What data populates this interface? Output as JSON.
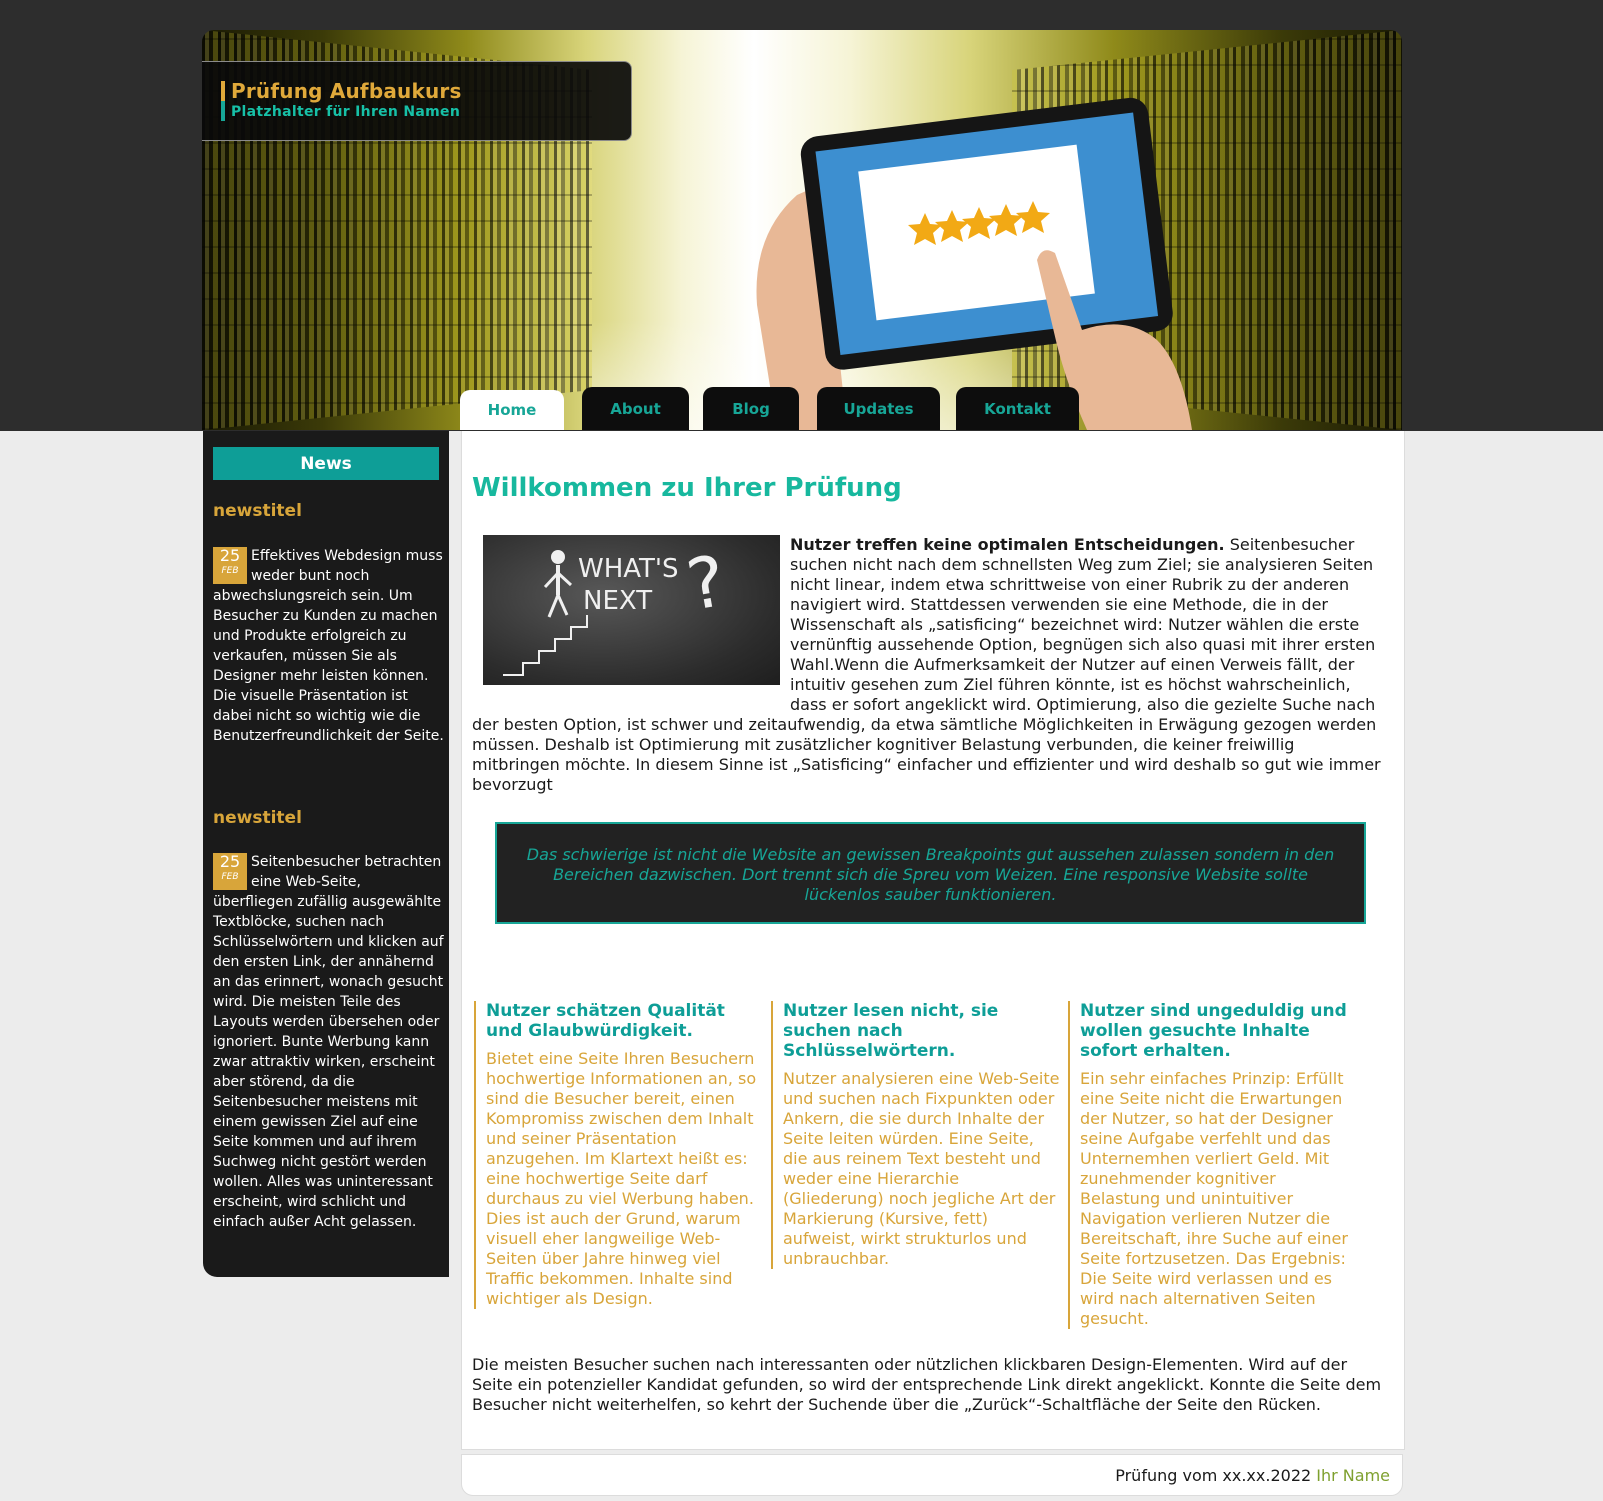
{
  "brand": {
    "title": "Prüfung Aufbaukurs",
    "subtitle": "Platzhalter für Ihren Namen"
  },
  "nav": {
    "items": [
      {
        "label": "Home",
        "active": true
      },
      {
        "label": "About",
        "active": false
      },
      {
        "label": "Blog",
        "active": false
      },
      {
        "label": "Updates",
        "active": false
      },
      {
        "label": "Kontakt",
        "active": false
      }
    ]
  },
  "sidebar": {
    "heading": "News",
    "posts": [
      {
        "title": "newstitel",
        "day": "25",
        "month": "FEB",
        "text": "Effektives Webdesign muss weder bunt noch abwechslungsreich sein. Um Besucher zu Kunden zu machen und Produkte erfolgreich zu verkaufen, müssen Sie als Designer mehr leisten können. Die visuelle Präsentation ist dabei nicht so wichtig wie die Benutzerfreundlichkeit der Seite."
      },
      {
        "title": "newstitel",
        "day": "25",
        "month": "FEB",
        "text": "Seitenbesucher betrachten eine Web-Seite, überfliegen zufällig ausgewählte Textblöcke, suchen nach Schlüsselwörtern und klicken auf den ersten Link, der annähernd an das erinnert, wonach gesucht wird. Die meisten Teile des Layouts werden übersehen oder ignoriert. Bunte Werbung kann zwar attraktiv wirken, erscheint aber störend, da die Seitenbesucher meistens mit einem gewissen Ziel auf eine Seite kommen und auf ihrem Suchweg nicht gestört werden wollen. Alles was uninteressant erscheint, wird schlicht und einfach außer Acht gelassen."
      }
    ]
  },
  "main": {
    "heading": "Willkommen zu Ihrer Prüfung",
    "image": {
      "line1": "WHAT'S",
      "line2": "NEXT",
      "line3": "?"
    },
    "intro_bold": "Nutzer treffen keine optimalen Entscheidungen.",
    "intro_text": " Seitenbesucher suchen nicht nach dem schnellsten Weg zum Ziel; sie analysieren Seiten nicht linear, indem etwa schrittweise von einer Rubrik zu der anderen navigiert wird. Stattdessen verwenden sie eine Methode, die in der Wissenschaft als „satisficing“ bezeichnet wird: Nutzer wählen die erste vernünftig aussehende Option, begnügen sich also quasi mit ihrer ersten Wahl.Wenn die Aufmerksamkeit der Nutzer auf einen Verweis fällt, der intuitiv gesehen zum Ziel führen könnte, ist es höchst wahrscheinlich, dass er sofort angeklickt wird. Optimierung, also die gezielte Suche nach der besten Option, ist schwer und zeitaufwendig, da etwa sämtliche Möglichkeiten in Erwägung gezogen werden müssen. Deshalb ist Optimierung mit zusätzlicher kognitiver Belastung verbunden, die keiner freiwillig mitbringen möchte. In diesem Sinne ist „Satisficing“ einfacher und effizienter und wird deshalb so gut wie immer bevorzugt",
    "quote": "Das schwierige ist nicht die Website an gewissen Breakpoints gut aussehen zulassen sondern in den Bereichen dazwischen. Dort trennt sich die Spreu vom Weizen. Eine responsive Website sollte lückenlos sauber funktionieren.",
    "columns": [
      {
        "title": "Nutzer schätzen Qualität und Glaubwürdigkeit.",
        "text": "Bietet eine Seite Ihren Besuchern hochwertige Informationen an, so sind die Besucher bereit, einen Kompromiss zwischen dem Inhalt und seiner Präsentation anzugehen. Im Klartext heißt es: eine hochwertige Seite darf durchaus zu viel Werbung haben. Dies ist auch der Grund, warum visuell eher langweilige Web-Seiten über Jahre hinweg viel Traffic bekommen. Inhalte sind wichtiger als Design."
      },
      {
        "title": "Nutzer lesen nicht, sie suchen nach Schlüsselwörtern.",
        "text": "Nutzer analysieren eine Web-Seite und suchen nach Fixpunkten oder Ankern, die sie durch Inhalte der Seite leiten würden. Eine Seite, die aus reinem Text besteht und weder eine Hierarchie (Gliederung) noch jegliche Art der Markierung (Kursive, fett) aufweist, wirkt strukturlos und unbrauchbar."
      },
      {
        "title": "Nutzer sind ungeduldig und wollen gesuchte Inhalte sofort erhalten.",
        "text": "Ein sehr einfaches Prinzip: Erfüllt eine Seite nicht die Erwartungen der Nutzer, so hat der Designer seine Aufgabe verfehlt und das Unternemhen verliert Geld. Mit zunehmender kognitiver Belastung und unintuitiver Navigation verlieren Nutzer die Bereitschaft, ihre Suche auf einer Seite fortzusetzen. Das Ergebnis: Die Seite wird verlassen und es wird nach alternativen Seiten gesucht."
      }
    ],
    "outro": "Die meisten Besucher suchen nach interessanten oder nützlichen klickbaren Design-Elementen. Wird auf der Seite ein potenzieller Kandidat gefunden, so wird der entsprechende Link direkt angeklickt. Konnte die Seite dem Besucher nicht weiterhelfen, so kehrt der Suchende über die „Zurück“-Schaltfläche der Seite den Rücken."
  },
  "footer": {
    "text": "Prüfung vom xx.xx.2022",
    "name": "Ihr Name"
  },
  "colors": {
    "accent_teal": "#17a697",
    "accent_gold": "#d8a53a",
    "dark": "#1a1a1a",
    "footer_name": "#7ea02e"
  },
  "icons": {
    "rating": "star-icon",
    "stars_count": 5
  }
}
